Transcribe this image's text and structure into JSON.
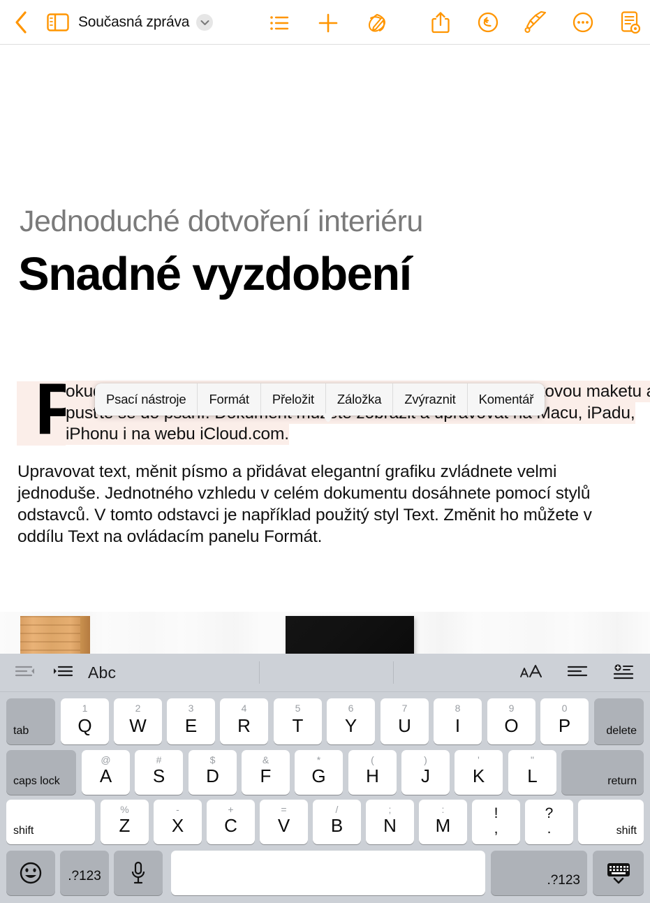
{
  "app": {
    "title": "Současná zpráva"
  },
  "toolbar": {
    "back_label": "back-chevron",
    "sidebar_label": "sidebar-toggle",
    "title_chevron": "chevron-down",
    "items": [
      {
        "name": "list-view-icon",
        "label": "Seznam"
      },
      {
        "name": "insert-icon",
        "label": "Vložit"
      },
      {
        "name": "markup-icon",
        "label": "Kresba"
      },
      {
        "name": "share-icon",
        "label": "Sdílet"
      },
      {
        "name": "undo-icon",
        "label": "Zpět"
      },
      {
        "name": "format-brush-icon",
        "label": "Formát"
      },
      {
        "name": "more-icon",
        "label": "Více"
      },
      {
        "name": "document-options-icon",
        "label": "Volby dokumentu"
      }
    ]
  },
  "document": {
    "eyebrow": "Jednoduché dotvoření interiéru",
    "headline": "Snadné vyzdobení",
    "dropcap": "P",
    "paragraph1": "okud chcete začít, jednoduše klepněte nebo klikněte na tuto textovou maketu a pusťte se do psaní. Dokument můžete zobrazit a upravovat na Macu, iPadu, iPhonu i na webu iCloud.com.",
    "paragraph2": "Upravovat text, měnit písmo a přidávat elegantní grafiku zvládnete velmi jednoduše. Jednotného vzhledu v celém dokumentu dosáhnete pomocí stylů odstavců. V tomto odstavci je například použitý styl Text. Změnit ho můžete v oddílu Text na ovládacím panelu Formát.",
    "highlight_color": "#fbeee9",
    "image_alt": "Interiér s dřevěným lamelovým panelem, bílými závěsy a černým obrazem"
  },
  "context_menu": {
    "items": [
      {
        "label": "Psací nástroje"
      },
      {
        "label": "Formát"
      },
      {
        "label": "Přeložit"
      },
      {
        "label": "Záložka"
      },
      {
        "label": "Zvýraznit"
      },
      {
        "label": "Komentář"
      }
    ]
  },
  "keyboard_toolbar": {
    "outdent": "outdent-icon",
    "indent": "indent-icon",
    "style_label": "Abc",
    "text_size": "text-size-icon",
    "align": "align-left-icon",
    "insert": "insert-row-icon"
  },
  "keyboard": {
    "row1": [
      {
        "main": "tab",
        "alt": "",
        "type": "mod-left"
      },
      {
        "main": "Q",
        "alt": "1",
        "type": "letter"
      },
      {
        "main": "W",
        "alt": "2",
        "type": "letter"
      },
      {
        "main": "E",
        "alt": "3",
        "type": "letter"
      },
      {
        "main": "R",
        "alt": "4",
        "type": "letter"
      },
      {
        "main": "T",
        "alt": "5",
        "type": "letter"
      },
      {
        "main": "Y",
        "alt": "6",
        "type": "letter"
      },
      {
        "main": "U",
        "alt": "7",
        "type": "letter"
      },
      {
        "main": "I",
        "alt": "8",
        "type": "letter"
      },
      {
        "main": "O",
        "alt": "9",
        "type": "letter"
      },
      {
        "main": "P",
        "alt": "0",
        "type": "letter"
      },
      {
        "main": "delete",
        "alt": "",
        "type": "mod-right"
      }
    ],
    "row2": [
      {
        "main": "caps lock",
        "alt": "",
        "type": "mod-left"
      },
      {
        "main": "A",
        "alt": "@",
        "type": "letter"
      },
      {
        "main": "S",
        "alt": "#",
        "type": "letter"
      },
      {
        "main": "D",
        "alt": "$",
        "type": "letter"
      },
      {
        "main": "F",
        "alt": "&",
        "type": "letter"
      },
      {
        "main": "G",
        "alt": "*",
        "type": "letter"
      },
      {
        "main": "H",
        "alt": "(",
        "type": "letter"
      },
      {
        "main": "J",
        "alt": ")",
        "type": "letter"
      },
      {
        "main": "K",
        "alt": "'",
        "type": "letter"
      },
      {
        "main": "L",
        "alt": "\"",
        "type": "letter"
      },
      {
        "main": "return",
        "alt": "",
        "type": "mod-right"
      }
    ],
    "row3": [
      {
        "main": "shift",
        "alt": "",
        "type": "shift-left"
      },
      {
        "main": "Z",
        "alt": "%",
        "type": "letter"
      },
      {
        "main": "X",
        "alt": "-",
        "type": "letter"
      },
      {
        "main": "C",
        "alt": "+",
        "type": "letter"
      },
      {
        "main": "V",
        "alt": "=",
        "type": "letter"
      },
      {
        "main": "B",
        "alt": "/",
        "type": "letter"
      },
      {
        "main": "N",
        "alt": ";",
        "type": "letter"
      },
      {
        "main": "M",
        "alt": ":",
        "type": "letter"
      },
      {
        "main": ",",
        "alt": "!",
        "type": "punct"
      },
      {
        "main": ".",
        "alt": "?",
        "type": "punct"
      },
      {
        "main": "shift",
        "alt": "",
        "type": "shift-right"
      }
    ],
    "row4": [
      {
        "main": "emoji-icon",
        "alt": "",
        "type": "icon"
      },
      {
        "main": ".?123",
        "alt": "",
        "type": "numeric-left"
      },
      {
        "main": "dictation-icon",
        "alt": "",
        "type": "icon"
      },
      {
        "main": "",
        "alt": "",
        "type": "space"
      },
      {
        "main": ".?123",
        "alt": "",
        "type": "numeric-right"
      },
      {
        "main": "hide-keyboard-icon",
        "alt": "",
        "type": "icon"
      }
    ]
  },
  "colors": {
    "accent": "#ff9500",
    "keyboard_bg": "#ccd0d6",
    "key_white": "#ffffff",
    "key_grey": "#aeb2b8",
    "highlight": "#fbeee9"
  }
}
